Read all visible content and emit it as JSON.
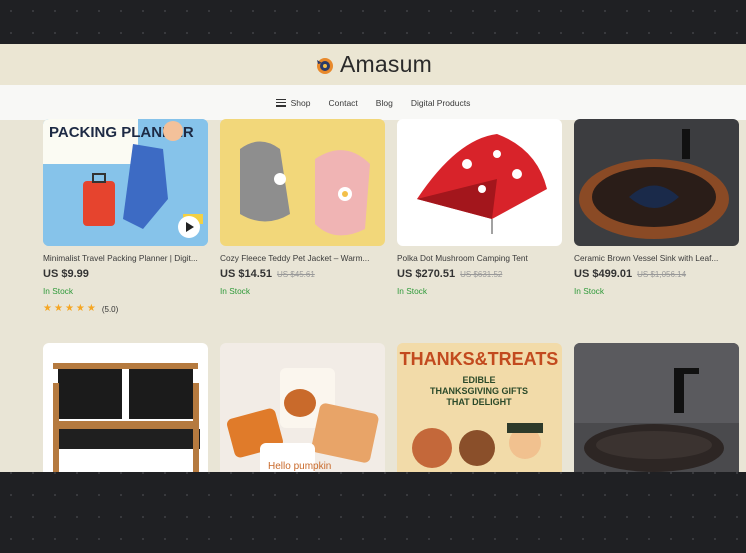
{
  "brand": {
    "name": "Amasum"
  },
  "nav": [
    {
      "label": "Shop",
      "icon": "hamburger-menu-icon"
    },
    {
      "label": "Contact"
    },
    {
      "label": "Blog"
    },
    {
      "label": "Digital Products"
    }
  ],
  "products": [
    {
      "title": "Minimalist Travel Packing Planner | Digit...",
      "price": "US $9.99",
      "old_price": "",
      "stock": "In Stock",
      "rating": "(5.0)",
      "image_text": "PACKING PLANNER"
    },
    {
      "title": "Cozy Fleece Teddy Pet Jacket – Warm...",
      "price": "US $14.51",
      "old_price": "US $45.61",
      "stock": "In Stock"
    },
    {
      "title": "Polka Dot Mushroom Camping Tent",
      "price": "US $270.51",
      "old_price": "US $631.52",
      "stock": "In Stock"
    },
    {
      "title": "Ceramic Brown Vessel Sink with Leaf...",
      "price": "US $499.01",
      "old_price": "US $1,056.14",
      "stock": "In Stock"
    },
    {
      "title": "",
      "image_text": ""
    },
    {
      "title": "",
      "image_text": "Hello pumpkin"
    },
    {
      "title": "",
      "image_text": "THANKS & TREATS EDIBLE THANKSGIVING GIFTS THAT DELIGHT"
    },
    {
      "title": ""
    }
  ],
  "colors": {
    "in_stock": "#2f9a3a",
    "star": "#f5a623",
    "background": "#e9e5d6"
  }
}
